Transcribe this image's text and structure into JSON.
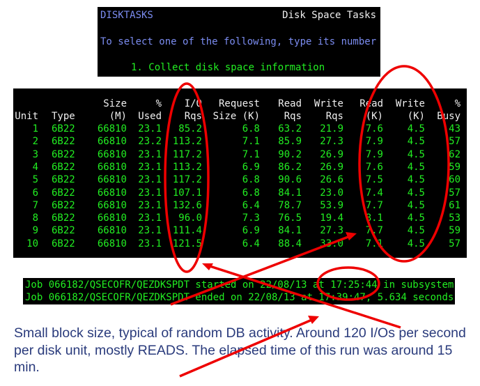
{
  "top_panel": {
    "screen_id": "DISKTASKS",
    "title": "Disk Space Tasks",
    "instruction": "To select one of the following, type its number",
    "options": [
      "1. Collect disk space information"
    ]
  },
  "table": {
    "headers_line1": [
      "",
      "",
      "Size",
      "%",
      "I/O",
      "Request",
      "Read",
      "Write",
      "Read",
      "Write",
      "%"
    ],
    "headers_line2": [
      "Unit",
      "Type",
      "(M)",
      "Used",
      "Rqs",
      "Size (K)",
      "Rqs",
      "Rqs",
      "(K)",
      "(K)",
      "Busy"
    ],
    "rows": [
      [
        "1",
        "6B22",
        "66810",
        "23.1",
        "85.2",
        "6.8",
        "63.2",
        "21.9",
        "7.6",
        "4.5",
        "43"
      ],
      [
        "2",
        "6B22",
        "66810",
        "23.2",
        "113.2",
        "7.1",
        "85.9",
        "27.3",
        "7.9",
        "4.5",
        "57"
      ],
      [
        "3",
        "6B22",
        "66810",
        "23.1",
        "117.2",
        "7.1",
        "90.2",
        "26.9",
        "7.9",
        "4.5",
        "62"
      ],
      [
        "4",
        "6B22",
        "66810",
        "23.1",
        "113.2",
        "6.9",
        "86.2",
        "26.9",
        "7.6",
        "4.5",
        "59"
      ],
      [
        "5",
        "6B22",
        "66810",
        "23.1",
        "117.2",
        "6.8",
        "90.6",
        "26.6",
        "7.5",
        "4.5",
        "60"
      ],
      [
        "6",
        "6B22",
        "66810",
        "23.1",
        "107.1",
        "6.8",
        "84.1",
        "23.0",
        "7.4",
        "4.5",
        "57"
      ],
      [
        "7",
        "6B22",
        "66810",
        "23.1",
        "132.6",
        "6.4",
        "78.7",
        "53.9",
        "7.7",
        "4.5",
        "61"
      ],
      [
        "8",
        "6B22",
        "66810",
        "23.1",
        "96.0",
        "7.3",
        "76.5",
        "19.4",
        "8.1",
        "4.5",
        "53"
      ],
      [
        "9",
        "6B22",
        "66810",
        "23.1",
        "111.4",
        "6.9",
        "84.1",
        "27.3",
        "7.7",
        "4.5",
        "59"
      ],
      [
        "10",
        "6B22",
        "66810",
        "23.1",
        "121.5",
        "6.4",
        "88.4",
        "33.0",
        "7.1",
        "4.5",
        "57"
      ]
    ]
  },
  "job_log": [
    "Job 066182/QSECOFR/QEZDKSPDT started on 22/08/13 at 17:25:44 in subsystem",
    "Job 066182/QSECOFR/QEZDKSPDT ended on 22/08/13 at 17:39:47; 5.634 seconds"
  ],
  "caption": "Small block size, typical of random DB activity. Around 120 I/Os per second per disk unit, mostly READS. The elapsed time of this run was around 15 min.",
  "colors": {
    "terminal_bg": "#000000",
    "terminal_green": "#22ee22",
    "terminal_blue": "#7b8cf0",
    "annotation_red": "#ee0000",
    "caption_text": "#2a3b7c"
  }
}
